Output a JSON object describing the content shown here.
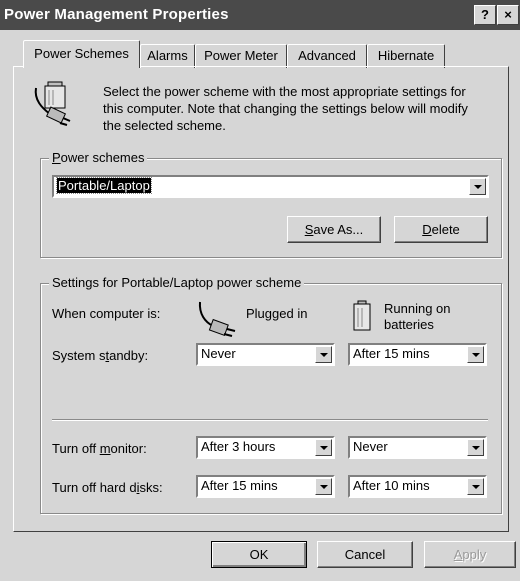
{
  "window": {
    "title": "Power Management Properties",
    "help_label": "?",
    "close_label": "×"
  },
  "tabs": [
    {
      "label": "Power Schemes",
      "active": true
    },
    {
      "label": "Alarms",
      "active": false
    },
    {
      "label": "Power Meter",
      "active": false
    },
    {
      "label": "Advanced",
      "active": false
    },
    {
      "label": "Hibernate",
      "active": false
    }
  ],
  "intro": {
    "line1": "Select the power scheme with the most appropriate settings for",
    "line2": "this computer. Note that changing the settings below will modify",
    "line3": "the selected scheme."
  },
  "schemes_group": {
    "legend_prefix": "",
    "legend_accel": "P",
    "legend_rest": "ower schemes",
    "selected": "Portable/Laptop",
    "save_as_accel": "S",
    "save_as_rest": "ave As...",
    "delete_accel": "D",
    "delete_rest": "elete"
  },
  "settings_group": {
    "legend": "Settings for Portable/Laptop power scheme",
    "when_label": "When computer is:",
    "plugged_label": "Plugged in",
    "battery_line1": "Running on",
    "battery_line2": "batteries",
    "standby": {
      "prefix": "System s",
      "accel": "t",
      "rest": "andby:",
      "plugged": "Never",
      "battery": "After 15 mins"
    },
    "monitor": {
      "prefix": "Turn off ",
      "accel": "m",
      "rest": "onitor:",
      "plugged": "After 3 hours",
      "battery": "Never"
    },
    "disks": {
      "prefix": "Turn off hard d",
      "accel": "i",
      "rest": "sks:",
      "plugged": "After 15 mins",
      "battery": "After 10 mins"
    }
  },
  "footer": {
    "ok": "OK",
    "cancel": "Cancel",
    "apply_accel": "A",
    "apply_rest": "pply"
  }
}
